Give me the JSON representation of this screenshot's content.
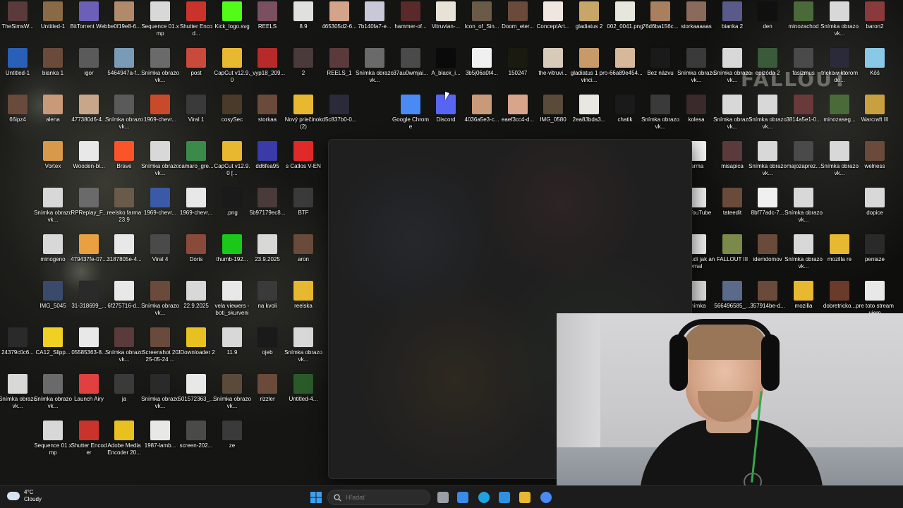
{
  "wallpaper": {
    "logo_text": "FALLOUT"
  },
  "desktop_icons": [
    {
      "label": "TheSimsW...",
      "color": "#5a3a3a"
    },
    {
      "label": "Untitled-1",
      "color": "#8a6a44"
    },
    {
      "label": "BitTorrent Web",
      "color": "#6b5fb8"
    },
    {
      "label": "be0f19e8-6...",
      "color": "#b08a6a"
    },
    {
      "label": "Sequence 01.xmp",
      "color": "#d8d8d8"
    },
    {
      "label": "Shutter Encod...",
      "color": "#c9332b"
    },
    {
      "label": "Kick_logo.svg",
      "color": "#53fc18"
    },
    {
      "label": "REELS",
      "color": "#7a5060"
    },
    {
      "label": "8.9",
      "color": "#e0e0e0"
    },
    {
      "label": "465305d2-6...",
      "color": "#d4a48a"
    },
    {
      "label": "7b140fa7-e...",
      "color": "#c8c8d8"
    },
    {
      "label": "hammer-of...",
      "color": "#5a2a2a"
    },
    {
      "label": "Vitruvian-...",
      "color": "#e8e2d6"
    },
    {
      "label": "Icon_of_Sin...",
      "color": "#6a5a48"
    },
    {
      "label": "Doom_eter...",
      "color": "#6a4a3a"
    },
    {
      "label": "ConceptArt...",
      "color": "#f0e6e0"
    },
    {
      "label": "gladiatus 2",
      "color": "#c8a66a"
    },
    {
      "label": "002_0041.png",
      "color": "#e6e6dc"
    },
    {
      "label": "76d6ba156c...",
      "color": "#a88060"
    },
    {
      "label": "storkaaaaas",
      "color": "#8a6a5a"
    },
    {
      "label": "bianka 2",
      "color": "#5a5a8a"
    },
    {
      "label": "den",
      "color": "#101010"
    },
    {
      "label": "minozachod",
      "color": "#4a6a3a"
    },
    {
      "label": "Snímka obrazovk...",
      "color": "#d8d8d8"
    },
    {
      "label": "baron2",
      "color": "#8a3a3a"
    },
    {
      "label": "Untitled-1",
      "color": "#2a5fb8"
    },
    {
      "label": "bianka 1",
      "color": "#6a4a3a"
    },
    {
      "label": "igor",
      "color": "#5a5a5a"
    },
    {
      "label": "5464947a-f...",
      "color": "#7a9ab8"
    },
    {
      "label": "Snímka obrazovk...",
      "color": "#6a6a6a"
    },
    {
      "label": "post",
      "color": "#c84a3a"
    },
    {
      "label": "CapCut v12.9.0",
      "color": "#e8b830"
    },
    {
      "label": "_vyp18_209...",
      "color": "#b82a2a"
    },
    {
      "label": "2",
      "color": "#4a3a3a"
    },
    {
      "label": "REELS_1",
      "color": "#5a3a3a"
    },
    {
      "label": "Snímka obrazovk...",
      "color": "#6a6a6a"
    },
    {
      "label": "37au0wmjai...",
      "color": "#4a4a4a"
    },
    {
      "label": "A_black_i...",
      "color": "#0a0a0a"
    },
    {
      "label": "3b5j06a0t4...",
      "color": "#f0f0f0"
    },
    {
      "label": "150247",
      "color": "#1a1a10"
    },
    {
      "label": "the-vitruvi...",
      "color": "#d8cab8"
    },
    {
      "label": "gladiatus 1 provinci...",
      "color": "#c89a6a"
    },
    {
      "label": "-66a89e454...",
      "color": "#d8b89a"
    },
    {
      "label": "Bez názvu",
      "color": "#1a1a1a"
    },
    {
      "label": "Snímka obrazovk...",
      "color": "#3a3a3a"
    },
    {
      "label": "Snímka obrazovk...",
      "color": "#d8d8d8"
    },
    {
      "label": "epizóda 2",
      "color": "#3a5a3a"
    },
    {
      "label": "fasizmus",
      "color": "#4a4a4a"
    },
    {
      "label": "tricko v ktorom de...",
      "color": "#2a2a3a"
    },
    {
      "label": "Kôš",
      "color": "#8ac8e8"
    },
    {
      "label": "66ipz4",
      "color": "#6a4a3a"
    },
    {
      "label": "alena",
      "color": "#c89a7a"
    },
    {
      "label": "477380d6-4...",
      "color": "#c8a68a"
    },
    {
      "label": "Snímka obrazovk...",
      "color": "#5a5a5a"
    },
    {
      "label": "1969-chevr...",
      "color": "#c84a2a"
    },
    {
      "label": "Viral 1",
      "color": "#3a3a3a"
    },
    {
      "label": "cosySec",
      "color": "#4a3a2a"
    },
    {
      "label": "storkaa",
      "color": "#6a4a3a"
    },
    {
      "label": "Nový priečinok (2)",
      "color": "#e8b830"
    },
    {
      "label": "d5c837b0-0...",
      "color": "#2a2a3a"
    },
    {
      "label": "Google Chrome",
      "color": "#4a8af4"
    },
    {
      "label": "Discord",
      "color": "#5865f2"
    },
    {
      "label": "4036a5e3-c...",
      "color": "#c89a7a"
    },
    {
      "label": "eaef3cc4-d...",
      "color": "#d8a48a"
    },
    {
      "label": "IMG_0580",
      "color": "#5a4a3a"
    },
    {
      "label": "2ea83bda3...",
      "color": "#e8e8e0"
    },
    {
      "label": "chatik",
      "color": "#1a1a1a"
    },
    {
      "label": "Snímka obrazovk...",
      "color": "#3a3a3a"
    },
    {
      "label": "kolesa",
      "color": "#3a2a2a"
    },
    {
      "label": "Snímka obrazovk...",
      "color": "#d8d8d8"
    },
    {
      "label": "Snímka obrazovk...",
      "color": "#d8d8d8"
    },
    {
      "label": "3814a5e1-0...",
      "color": "#6a3a3a"
    },
    {
      "label": "minozaseg...",
      "color": "#4a6a3a"
    },
    {
      "label": "Warcraft III",
      "color": "#c8a040"
    },
    {
      "label": "Vortex",
      "color": "#d89a4a"
    },
    {
      "label": "Wooden-bl...",
      "color": "#e8e8e8"
    },
    {
      "label": "Brave",
      "color": "#fb542b"
    },
    {
      "label": "Snímka obrazovk...",
      "color": "#d8d8d8"
    },
    {
      "label": "camaro_gre...",
      "color": "#3a8a4a"
    },
    {
      "label": "CapCut v12.9.0 [...",
      "color": "#e8b830"
    },
    {
      "label": "dd6fea95",
      "color": "#3a3aa8"
    },
    {
      "label": "s Catlos V-EN",
      "color": "#e02a2a"
    },
    {
      "label": "farma",
      "color": "#f0f0f0"
    },
    {
      "label": "misapica",
      "color": "#5a3a3a"
    },
    {
      "label": "Snímka obrazovk...",
      "color": "#d8d8d8"
    },
    {
      "label": "majozaprez...",
      "color": "#4a4a4a"
    },
    {
      "label": "Snímka obrazovk...",
      "color": "#d8d8d8"
    },
    {
      "label": "welness",
      "color": "#6a4a3a"
    },
    {
      "label": "Snímka obrazovk...",
      "color": "#d8d8d8"
    },
    {
      "label": "RPReplay_F...",
      "color": "#6a6a6a"
    },
    {
      "label": "reelsko farma 23.9",
      "color": "#6a5a4a"
    },
    {
      "label": "1969-chevr...",
      "color": "#3a5aa8"
    },
    {
      "label": "1969-chevr...",
      "color": "#e8e8e8"
    },
    {
      "label": ".png",
      "color": "#1a1a1a"
    },
    {
      "label": "5b97179ec8...",
      "color": "#4a3a3a"
    },
    {
      "label": "BTF",
      "color": "#3a3a3a"
    },
    {
      "label": "59 YouTube",
      "color": "#e8e8e8"
    },
    {
      "label": "tateedit",
      "color": "#6a4a3a"
    },
    {
      "label": "8bf77adc-7...",
      "color": "#f0f0f0"
    },
    {
      "label": "Snímka obrazovk...",
      "color": "#d8d8d8"
    },
    {
      "label": "dopice",
      "color": "#d8d8d8"
    },
    {
      "label": "minogeno",
      "color": "#d8d8d8"
    },
    {
      "label": "479437fe-07...",
      "color": "#e8a040"
    },
    {
      "label": "3187805e-4...",
      "color": "#e8e8e8"
    },
    {
      "label": "Viral 4",
      "color": "#4a4a4a"
    },
    {
      "label": "Doris",
      "color": "#8a4a3a"
    },
    {
      "label": "thumb-192...",
      "color": "#1ac81a"
    },
    {
      "label": "23.9.2025",
      "color": "#d8d8d8"
    },
    {
      "label": "aron",
      "color": "#6a4a3a"
    },
    {
      "label": "viac ludi jak anymal",
      "color": "#e8e8e8"
    },
    {
      "label": "FALLOUT III",
      "color": "#7a8a4a"
    },
    {
      "label": "idemdomov",
      "color": "#6a4a3a"
    },
    {
      "label": "Snímka obrazovk...",
      "color": "#d8d8d8"
    },
    {
      "label": "mozilla re",
      "color": "#e8b830"
    },
    {
      "label": "peniaze",
      "color": "#2a2a2a"
    },
    {
      "label": "IMG_5045",
      "color": "#3a4a6a"
    },
    {
      "label": "31-318699_...",
      "color": "#2a2a2a"
    },
    {
      "label": "6f275716-d...",
      "color": "#e8e8e8"
    },
    {
      "label": "Snímka obrazovk...",
      "color": "#6a4a3a"
    },
    {
      "label": "22.9.2025",
      "color": "#d8d8d8"
    },
    {
      "label": "vela viewers - boti_skurveni",
      "color": "#e8e8e8"
    },
    {
      "label": "na kvoli",
      "color": "#3a3a3a"
    },
    {
      "label": "reelska",
      "color": "#e8b830"
    },
    {
      "label": "Snímka",
      "color": "#d8d8d8"
    },
    {
      "label": "566496585_...",
      "color": "#5a6a8a"
    },
    {
      "label": "357914be-d...",
      "color": "#6a4a3a"
    },
    {
      "label": "mozilla",
      "color": "#e8b830"
    },
    {
      "label": "dobretricko...",
      "color": "#6a3a2a"
    },
    {
      "label": "pre toto streamujem",
      "color": "#e8e8e8"
    },
    {
      "label": "24379c0c6...",
      "color": "#2a2a2a"
    },
    {
      "label": "CA12_Slipp...",
      "color": "#f0d020"
    },
    {
      "label": "05585363-8...",
      "color": "#e8e8e8"
    },
    {
      "label": "Snímka obrazovk...",
      "color": "#5a3a3a"
    },
    {
      "label": "Screenshot 2025-05-24 ...",
      "color": "#6a4a3a"
    },
    {
      "label": "JDownloader 2",
      "color": "#e8c020"
    },
    {
      "label": "11.9",
      "color": "#d8d8d8"
    },
    {
      "label": "ojeb",
      "color": "#1a1a1a"
    },
    {
      "label": "Snímka obrazovk...",
      "color": "#d8d8d8"
    },
    {
      "label": "Snímka obrazovk...",
      "color": "#d8d8d8"
    },
    {
      "label": "Snímka obrazovk...",
      "color": "#6a6a6a"
    },
    {
      "label": "Launch Airy",
      "color": "#e04040"
    },
    {
      "label": "ja",
      "color": "#3a3a3a"
    },
    {
      "label": "Snímka obrazovk...",
      "color": "#2a2a2a"
    },
    {
      "label": "501572363_...",
      "color": "#e8e8e8"
    },
    {
      "label": "Snímka obrazovk...",
      "color": "#5a4a3a"
    },
    {
      "label": "rizzler",
      "color": "#6a4a3a"
    },
    {
      "label": "Untitled-4...",
      "color": "#2a5a2a"
    },
    {
      "label": "Sequence 01.xmp",
      "color": "#d8d8d8"
    },
    {
      "label": "Shutter Encoder",
      "color": "#c9332b"
    },
    {
      "label": "Adobe Media Encoder 20...",
      "color": "#e8c020"
    },
    {
      "label": "1987-lamb...",
      "color": "#e8e8e8"
    },
    {
      "label": "screen-202...",
      "color": "#4a4a4a"
    },
    {
      "label": "ze",
      "color": "#3a3a3a"
    }
  ],
  "taskbar": {
    "weather_temp": "4°C",
    "weather_desc": "Cloudy",
    "search_placeholder": "Hľadať",
    "apps": [
      {
        "name": "task-view",
        "color": "#9aa0a6"
      },
      {
        "name": "store",
        "color": "#3a8ae8"
      },
      {
        "name": "edge",
        "color": "#1fa2e0"
      },
      {
        "name": "photos",
        "color": "#2e90e0"
      },
      {
        "name": "file-explorer",
        "color": "#e8b830"
      },
      {
        "name": "chrome",
        "color": "#4a8af4"
      }
    ]
  }
}
